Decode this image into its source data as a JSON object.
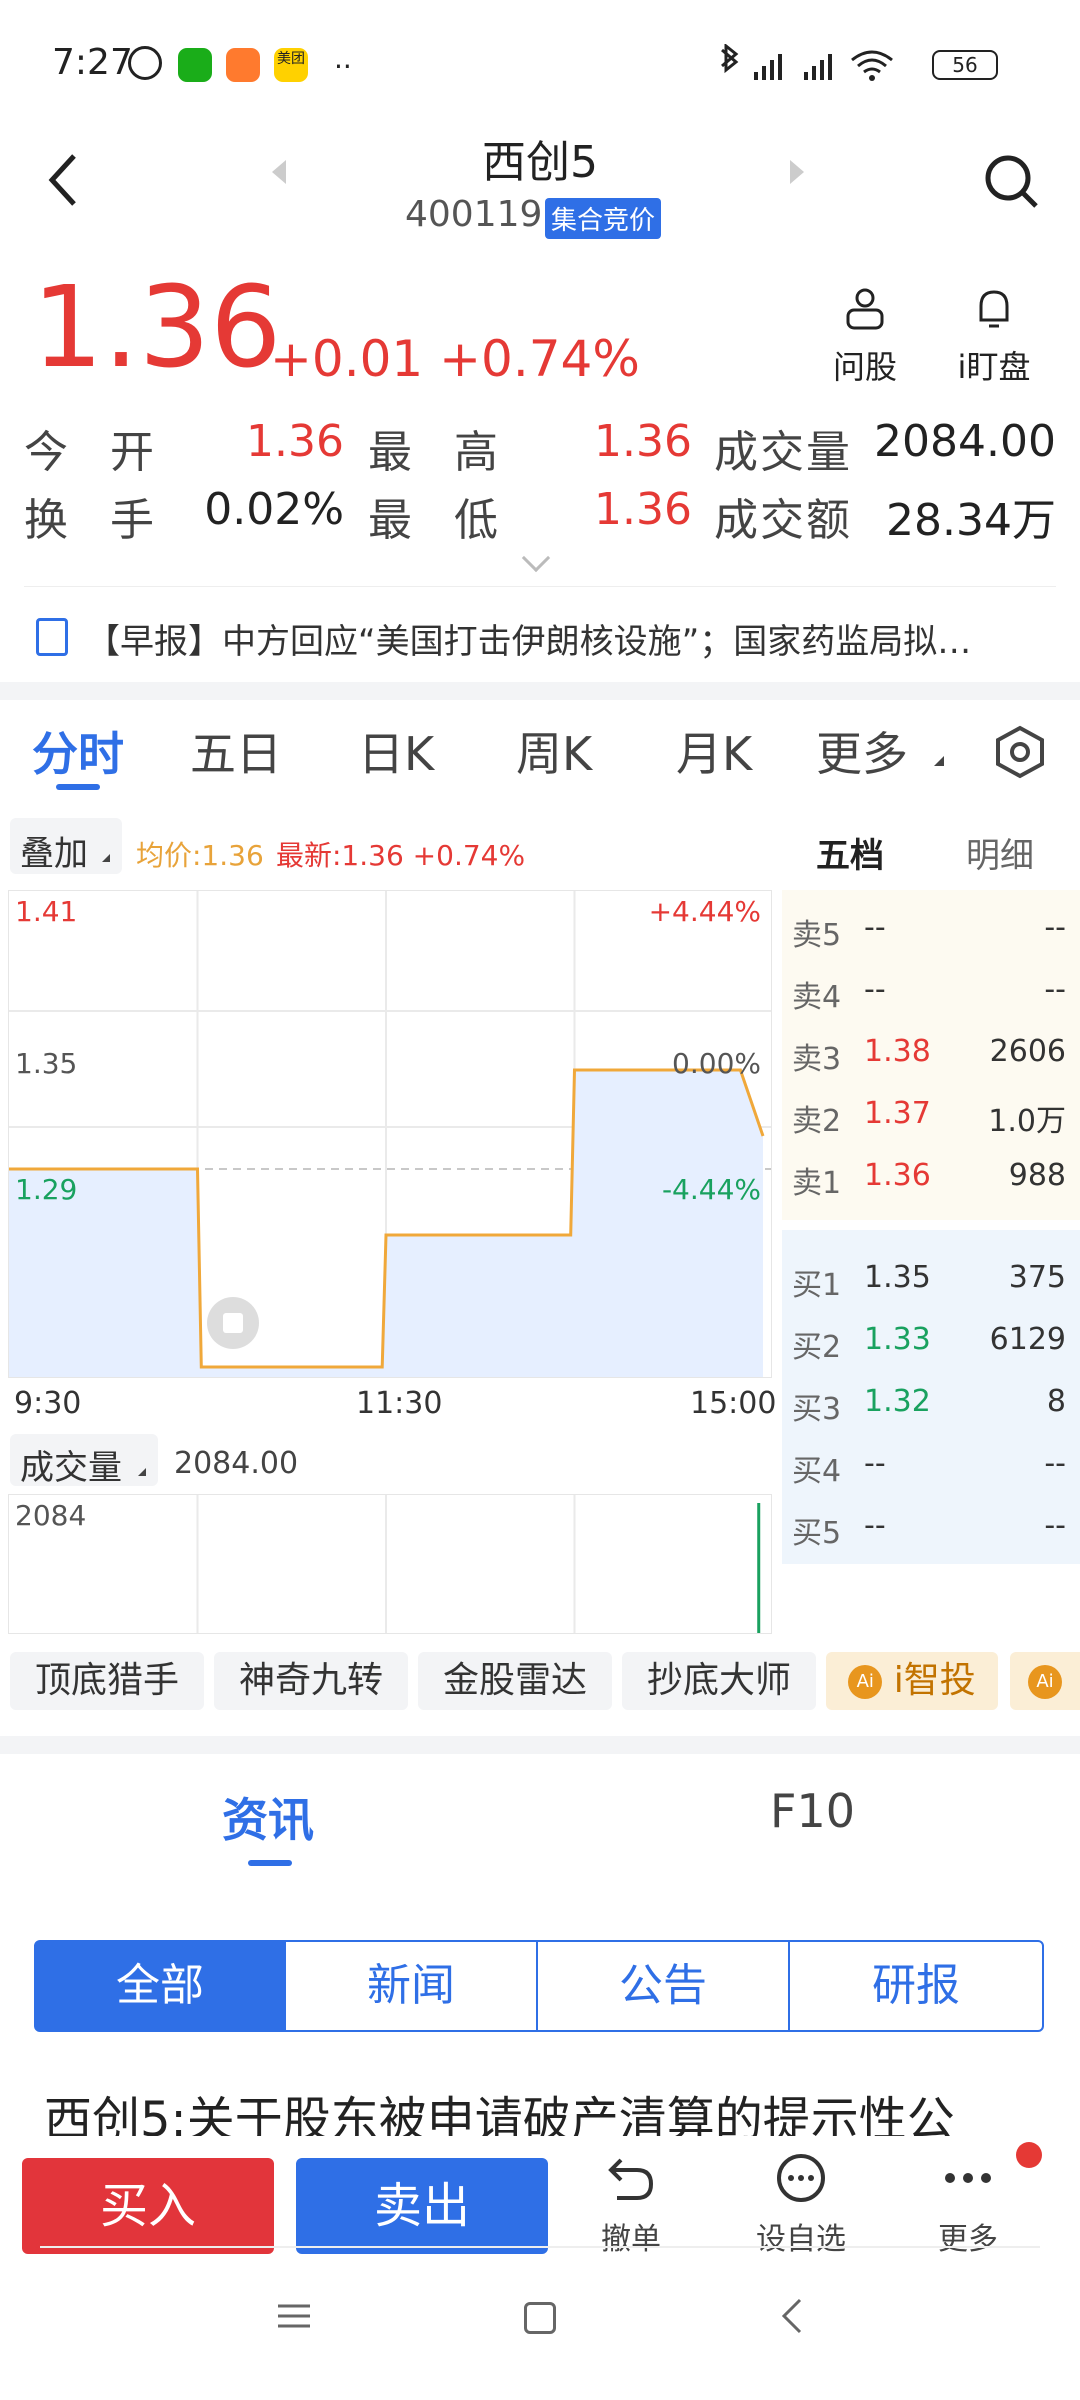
{
  "status_bar": {
    "time": "7:27",
    "battery": "56",
    "icons": [
      "alarm-icon",
      "wechat-icon",
      "shopping-icon",
      "meituan-icon",
      "more-dots-icon",
      "bluetooth-icon",
      "signal-hd-icon",
      "signal-hd-icon",
      "wifi-icon",
      "battery-icon"
    ],
    "meituan_label": "美团"
  },
  "header": {
    "stock_name": "西创5",
    "stock_code": "400119",
    "phase_badge": "集合竞价"
  },
  "quote": {
    "price": "1.36",
    "change": "+0.01",
    "change_pct": "+0.74%",
    "ask_stock_label": "问股",
    "watch_label": "i盯盘"
  },
  "stats": {
    "open_label": "今 开",
    "open_value": "1.36",
    "high_label": "最 高",
    "high_value": "1.36",
    "volume_label": "成交量",
    "volume_value": "2084.00",
    "turnover_label": "换 手",
    "turnover_value": "0.02%",
    "low_label": "最 低",
    "low_value": "1.36",
    "amount_label": "成交额",
    "amount_value": "28.34万"
  },
  "news_ticker": "【早报】中方回应“美国打击伊朗核设施”；国家药监局拟…",
  "chart_tabs": [
    "分时",
    "五日",
    "日K",
    "周K",
    "月K",
    "更多"
  ],
  "chart_header": {
    "overlay_label": "叠加",
    "avg_price": "均价:1.36",
    "latest": "最新:1.36 +0.74%",
    "tab_five": "五档",
    "tab_detail": "明细"
  },
  "chart_data": {
    "type": "line",
    "x_ticks": [
      "9:30",
      "11:30",
      "15:00"
    ],
    "y_left_ticks": [
      "1.41",
      "1.35",
      "1.29"
    ],
    "y_right_ticks": [
      "+4.44%",
      "0.00%",
      "-4.44%"
    ],
    "ylim": [
      1.29,
      1.41
    ],
    "baseline": 1.35,
    "points": [
      {
        "t": 0.0,
        "p": 1.35
      },
      {
        "t": 0.25,
        "p": 1.35
      },
      {
        "t": 0.255,
        "p": 1.29
      },
      {
        "t": 0.495,
        "p": 1.29
      },
      {
        "t": 0.5,
        "p": 1.33
      },
      {
        "t": 0.745,
        "p": 1.33
      },
      {
        "t": 0.75,
        "p": 1.38
      },
      {
        "t": 0.97,
        "p": 1.38
      },
      {
        "t": 0.985,
        "p": 1.37
      },
      {
        "t": 1.0,
        "p": 1.36
      }
    ],
    "volume_label": "成交量",
    "volume_value": "2084.00",
    "volume_max": "2084",
    "volume_bars": [
      {
        "t": 0.995,
        "v": 2084
      }
    ],
    "line_color": "#f0a83a",
    "fill_color": "#e6efff",
    "volume_color": "#19a15f"
  },
  "order_book": {
    "asks": [
      {
        "label": "卖5",
        "price": "--",
        "vol": "--"
      },
      {
        "label": "卖4",
        "price": "--",
        "vol": "--"
      },
      {
        "label": "卖3",
        "price": "1.38",
        "vol": "2606"
      },
      {
        "label": "卖2",
        "price": "1.37",
        "vol": "1.0万"
      },
      {
        "label": "卖1",
        "price": "1.36",
        "vol": "988"
      }
    ],
    "bids": [
      {
        "label": "买1",
        "price": "1.35",
        "vol": "375"
      },
      {
        "label": "买2",
        "price": "1.33",
        "vol": "6129"
      },
      {
        "label": "买3",
        "price": "1.32",
        "vol": "8"
      },
      {
        "label": "买4",
        "price": "--",
        "vol": "--"
      },
      {
        "label": "买5",
        "price": "--",
        "vol": "--"
      }
    ]
  },
  "tools": [
    "顶底猎手",
    "神奇九转",
    "金股雷达",
    "抄底大师",
    "i智投"
  ],
  "tools_ai_badge": "Ai",
  "info_tabs": [
    "资讯",
    "F10"
  ],
  "segments": [
    "全部",
    "新闻",
    "公告",
    "研报"
  ],
  "article_title": "西创5:关于股东被申请破产清算的提示性公",
  "bottom_bar": {
    "buy": "买入",
    "sell": "卖出",
    "cancel": "撤单",
    "add_watch": "设自选",
    "more": "更多"
  }
}
